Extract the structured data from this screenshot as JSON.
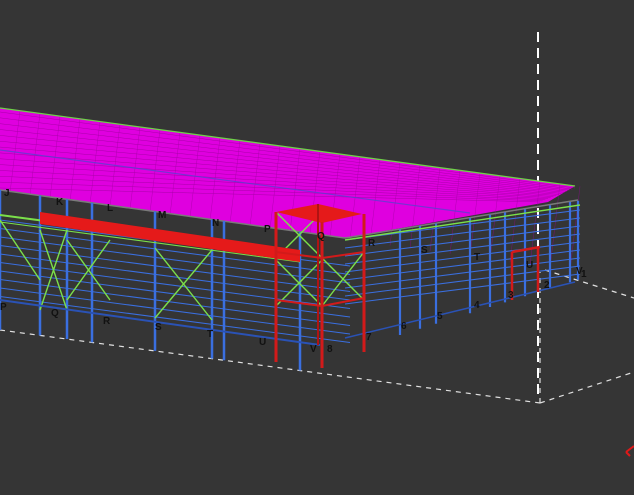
{
  "viewport": {
    "background": "#353535",
    "colors": {
      "roof": "#e000e0",
      "roof_line": "#9b009b",
      "column": "#3a6fe0",
      "column_dark": "#2a52b5",
      "bracing": "#7be04a",
      "highlight": "#e01818",
      "highlight_dark": "#a00e0e",
      "guide_line": "#ffffff",
      "label": "#111111"
    },
    "grid_labels_letters": [
      "J",
      "K",
      "L",
      "M",
      "N",
      "P",
      "Q",
      "R",
      "S",
      "T",
      "U",
      "V",
      "P",
      "Q",
      "R",
      "S",
      "T",
      "U",
      "V"
    ],
    "grid_labels_numbers": [
      "1",
      "2",
      "3",
      "4",
      "5",
      "6",
      "7",
      "8"
    ],
    "axis_marker": "red-axis-triad"
  }
}
